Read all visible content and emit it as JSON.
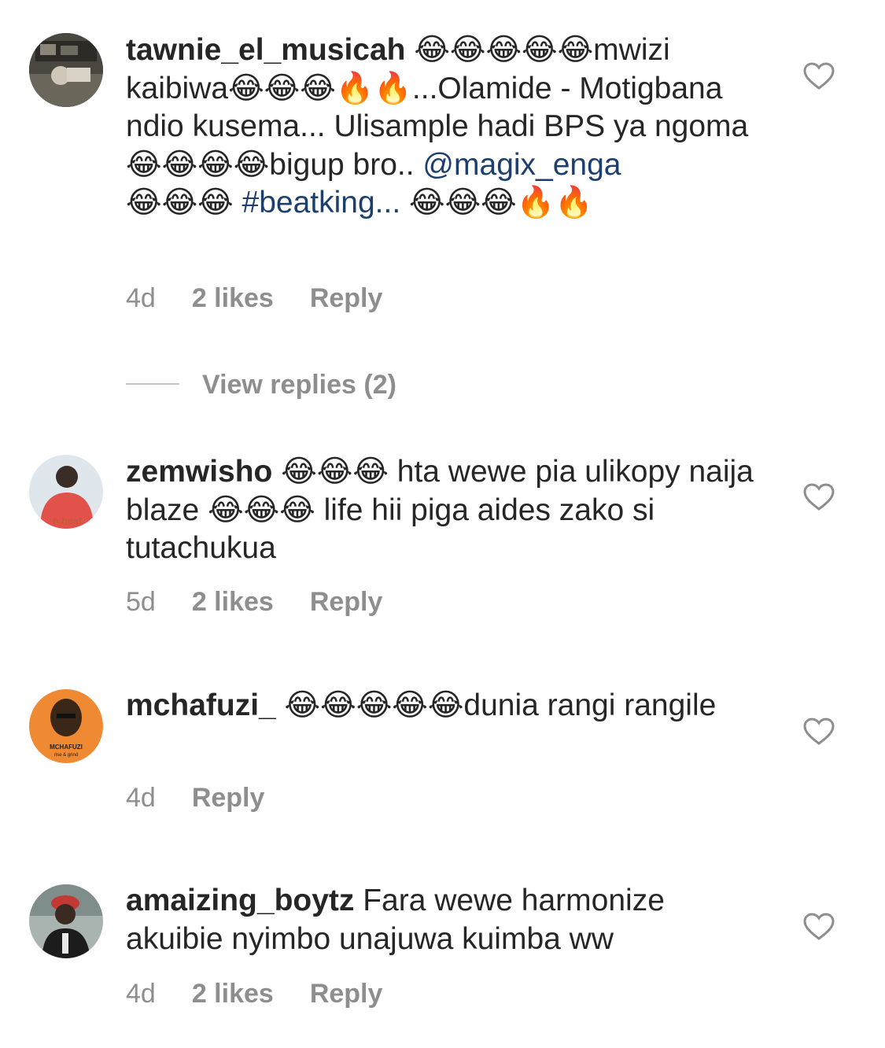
{
  "comments": [
    {
      "username": "tawnie_el_musicah",
      "text1": " 😂😂😂😂😂mwizi kaibiwa😂😂😂🔥🔥...Olamide - Motigbana ndio kusema... Ulisample hadi BPS  ya ngoma 😂😂😂😂bigup bro.. ",
      "mention": "@magix_enga",
      "text2": "😂😂😂 ",
      "hashtag": "#beatking...",
      "text3": " 😂😂😂🔥🔥",
      "time": "4d",
      "likes": "2 likes",
      "reply": "Reply"
    },
    {
      "username": "zemwisho",
      "text": " 😂😂😂 hta wewe pia ulikopy naija blaze 😂😂😂 life hii piga aides zako si tutachukua",
      "time": "5d",
      "likes": "2 likes",
      "reply": "Reply"
    },
    {
      "username": "mchafuzi_",
      "text": " 😂😂😂😂😂dunia rangi rangile",
      "time": "4d",
      "reply": "Reply",
      "avatar_text_1": "MCHAFUZI",
      "avatar_text_2": "rise & grind"
    },
    {
      "username": "amaizing_boytz",
      "text": " Fara wewe harmonize akuibie nyimbo unajuwa kuimba ww",
      "time": "4d",
      "likes": "2 likes",
      "reply": "Reply"
    }
  ],
  "view_replies": "View replies (2)",
  "icons": {
    "like": "heart-outline-icon"
  },
  "colors": {
    "meta": "#8e8e8e",
    "link": "#1c3f6e",
    "text": "#262626"
  }
}
